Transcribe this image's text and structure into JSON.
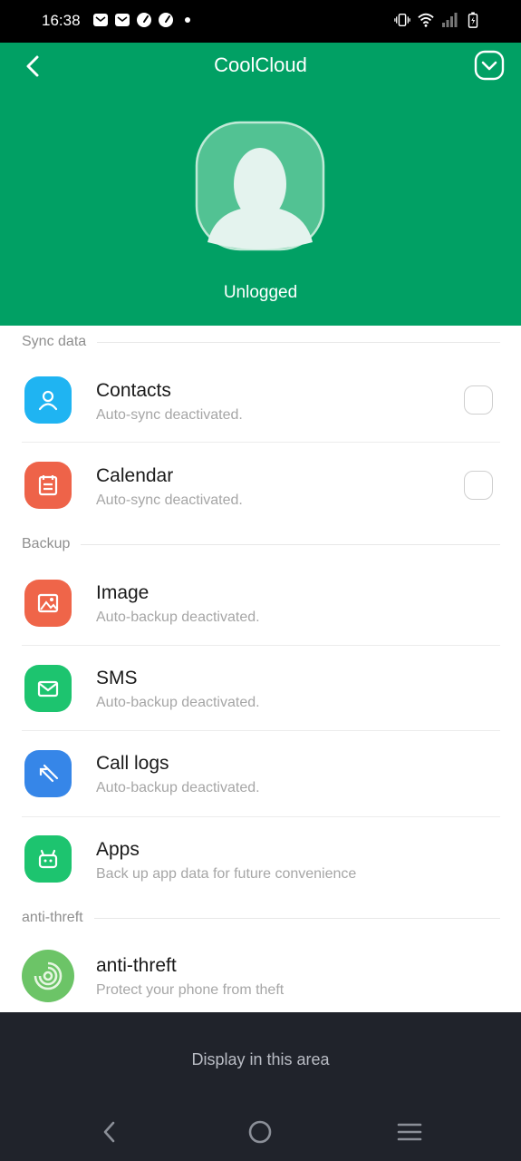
{
  "status_bar": {
    "time": "16:38",
    "left_icons": [
      "mail-icon",
      "mail-icon",
      "speedometer-icon",
      "speedometer-icon",
      "dot-icon"
    ],
    "right_icons": [
      "vibrate-icon",
      "wifi-icon",
      "signal-icon",
      "battery-charging-icon"
    ]
  },
  "header": {
    "title": "CoolCloud",
    "back_icon": "chevron-left-icon",
    "menu_icon": "chevron-down-circle-icon",
    "login_status": "Unlogged",
    "background_color": "#01a064"
  },
  "sections": {
    "sync": {
      "title": "Sync data",
      "items": [
        {
          "title": "Contacts",
          "subtitle": "Auto-sync deactivated.",
          "icon": "person-icon",
          "color": "#1fb4f2",
          "checked": false
        },
        {
          "title": "Calendar",
          "subtitle": "Auto-sync deactivated.",
          "icon": "calendar-icon",
          "color": "#ee6349",
          "checked": false
        }
      ]
    },
    "backup": {
      "title": "Backup",
      "items": [
        {
          "title": "Image",
          "subtitle": "Auto-backup deactivated.",
          "icon": "image-icon",
          "color": "#ef6549"
        },
        {
          "title": "SMS",
          "subtitle": "Auto-backup deactivated.",
          "icon": "mail-icon",
          "color": "#1dc46f"
        },
        {
          "title": "Call logs",
          "subtitle": "Auto-backup deactivated.",
          "icon": "phone-slash-icon",
          "color": "#3686e8"
        },
        {
          "title": "Apps",
          "subtitle": "Back up app data for future convenience",
          "icon": "android-icon",
          "color": "#1dc46f"
        }
      ]
    },
    "anti_theft": {
      "title": "anti-threft",
      "items": [
        {
          "title": "anti-threft",
          "subtitle": "Protect your phone from theft",
          "icon": "target-icon",
          "color": "#6cc467"
        }
      ]
    }
  },
  "bottom": {
    "text": "Display in this area",
    "nav": [
      "back-icon",
      "home-icon",
      "menu-icon"
    ]
  }
}
